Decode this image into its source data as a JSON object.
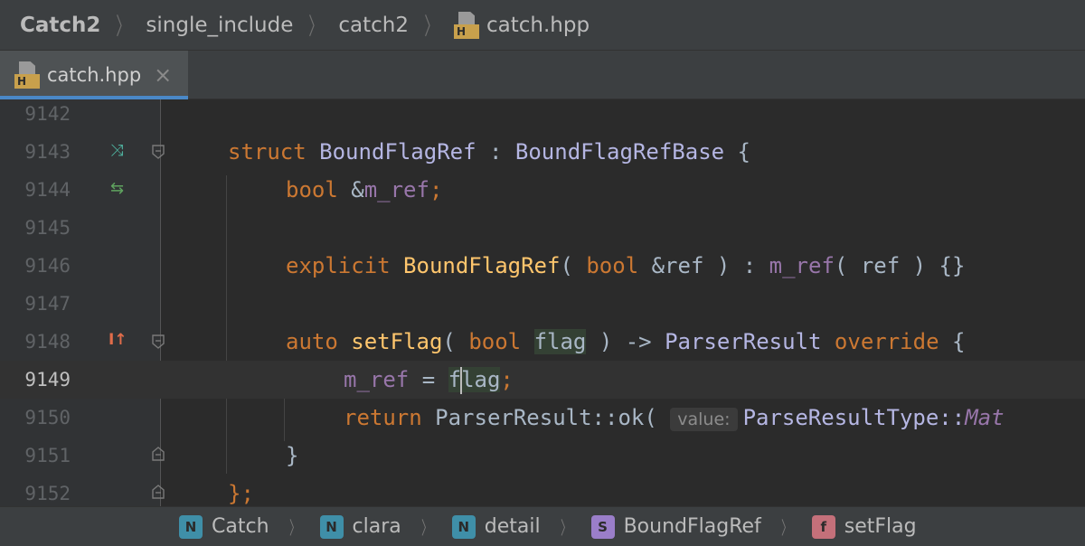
{
  "navbar": {
    "crumbs": [
      "Catch2",
      "single_include",
      "catch2",
      "catch.hpp"
    ],
    "file_icon": "header-file-icon"
  },
  "tabs": [
    {
      "label": "catch.hpp",
      "active": true,
      "icon": "header-file-icon",
      "close": "×"
    }
  ],
  "editor": {
    "current_line": 9149,
    "lines": [
      {
        "num": "9142"
      },
      {
        "num": "9143",
        "t": [
          "struct",
          "BoundFlagRef",
          ":",
          "BoundFlagRefBase",
          "{"
        ]
      },
      {
        "num": "9144",
        "t": [
          "bool",
          "&",
          "m_ref",
          ";"
        ]
      },
      {
        "num": "9145"
      },
      {
        "num": "9146",
        "t": [
          "explicit",
          "BoundFlagRef",
          "(",
          "bool",
          "&ref",
          ")",
          ":",
          "m_ref",
          "(",
          "ref",
          ")",
          "{}"
        ]
      },
      {
        "num": "9147"
      },
      {
        "num": "9148",
        "t": [
          "auto",
          "setFlag",
          "(",
          "bool",
          "flag",
          ")",
          "->",
          "ParserResult",
          "override",
          "{"
        ]
      },
      {
        "num": "9149",
        "t": [
          "m_ref",
          "=",
          "f",
          "lag",
          ";"
        ]
      },
      {
        "num": "9150",
        "t": [
          "return",
          "ParserResult::ok(",
          "value:",
          "ParseResultType::",
          "Mat"
        ]
      },
      {
        "num": "9151",
        "t": [
          "}"
        ]
      },
      {
        "num": "9152",
        "t": [
          "};"
        ]
      }
    ],
    "gutter_icons": {
      "9143": "implemented-icon",
      "9144": "overrides-swap-icon",
      "9148": "implements-up-icon"
    },
    "gutter_icon_glyphs": {
      "implemented-icon": "⤨",
      "overrides-swap-icon": "⇆",
      "implements-up-icon": "I↑"
    }
  },
  "bottom_breadcrumb": [
    {
      "badge": "N",
      "label": "Catch",
      "color": "#3f8fa8"
    },
    {
      "badge": "N",
      "label": "clara",
      "color": "#3f8fa8"
    },
    {
      "badge": "N",
      "label": "detail",
      "color": "#3f8fa8"
    },
    {
      "badge": "S",
      "label": "BoundFlagRef",
      "color": "#9a7ec9"
    },
    {
      "badge": "f",
      "label": "setFlag",
      "color": "#c4707a"
    }
  ],
  "separator_glyph": "〉"
}
